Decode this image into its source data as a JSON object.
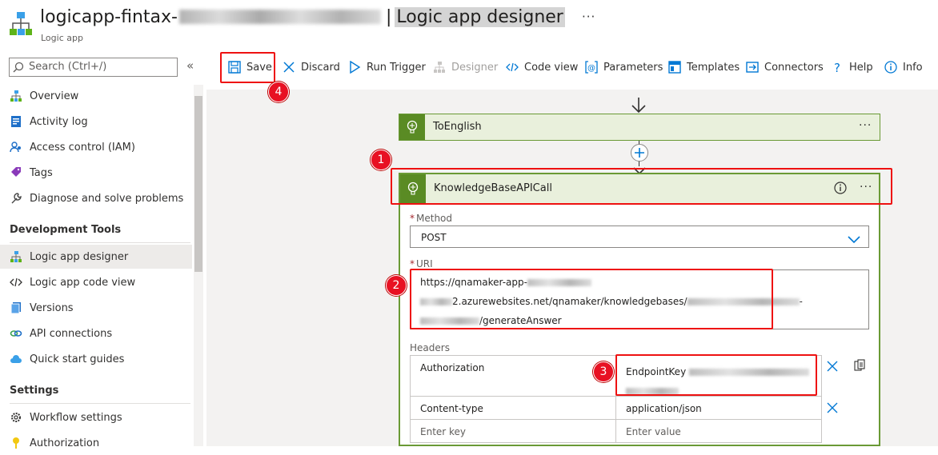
{
  "header": {
    "title_prefix": "logicapp-fintax-",
    "title_suffix": "Logic app designer",
    "subtitle": "Logic app",
    "more": "···"
  },
  "sidebar": {
    "search_placeholder": "Search (Ctrl+/)",
    "collapse": "«",
    "items": [
      {
        "label": "Overview",
        "icon": "overview-icon"
      },
      {
        "label": "Activity log",
        "icon": "activity-log-icon"
      },
      {
        "label": "Access control (IAM)",
        "icon": "iam-icon"
      },
      {
        "label": "Tags",
        "icon": "tag-icon"
      },
      {
        "label": "Diagnose and solve problems",
        "icon": "wrench-icon"
      }
    ],
    "sections": [
      {
        "title": "Development Tools",
        "items": [
          {
            "label": "Logic app designer",
            "icon": "designer-icon",
            "active": true
          },
          {
            "label": "Logic app code view",
            "icon": "code-icon"
          },
          {
            "label": "Versions",
            "icon": "versions-icon"
          },
          {
            "label": "API connections",
            "icon": "link-icon"
          },
          {
            "label": "Quick start guides",
            "icon": "cloud-icon"
          }
        ]
      },
      {
        "title": "Settings",
        "items": [
          {
            "label": "Workflow settings",
            "icon": "gear-icon"
          },
          {
            "label": "Authorization",
            "icon": "key-icon"
          }
        ]
      }
    ]
  },
  "toolbar": {
    "save": "Save",
    "discard": "Discard",
    "run_trigger": "Run Trigger",
    "designer": "Designer",
    "code_view": "Code view",
    "parameters": "Parameters",
    "templates": "Templates",
    "connectors": "Connectors",
    "help": "Help",
    "info": "Info"
  },
  "designer": {
    "step1": {
      "title": "ToEnglish",
      "more": "···"
    },
    "step2": {
      "title": "KnowledgeBaseAPICall",
      "more": "···",
      "method_label": "Method",
      "method_value": "POST",
      "uri_label": "URI",
      "uri_line1": "https://qnamaker-app-",
      "uri_line2a": "2.azurewebsites.net/qnamaker/knowledgebases/",
      "uri_line2b": "-",
      "uri_line3": "/generateAnswer",
      "headers_label": "Headers",
      "headers": [
        {
          "key": "Authorization",
          "value": "EndpointKey "
        },
        {
          "key": "Content-type",
          "value": "application/json"
        }
      ],
      "key_placeholder": "Enter key",
      "value_placeholder": "Enter value"
    }
  },
  "annotations": [
    "1",
    "2",
    "3",
    "4"
  ],
  "colors": {
    "accent": "#0078d4",
    "highlight": "#e81123",
    "card_header": "#e9f0dc",
    "card_icon": "#5a8b24"
  }
}
